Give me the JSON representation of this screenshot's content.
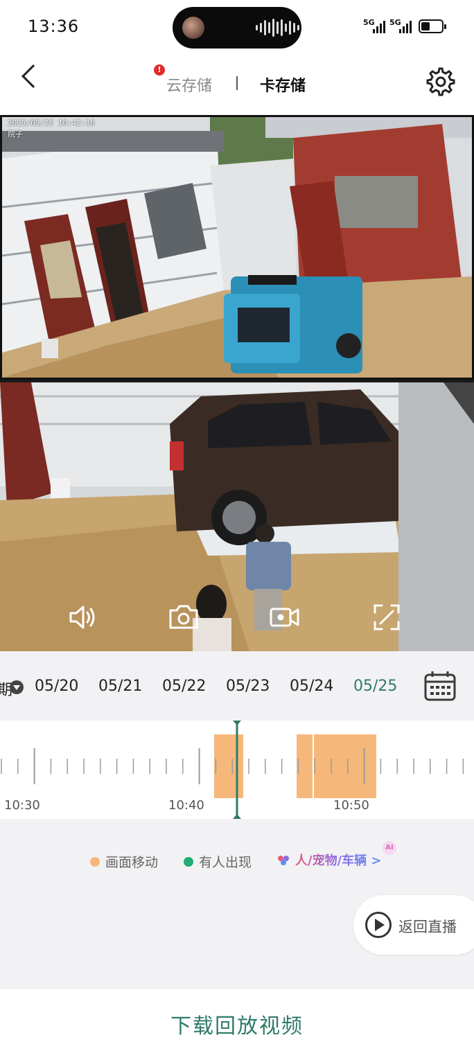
{
  "status_bar": {
    "time": "13:36",
    "network_1": "5G",
    "network_2": "5G"
  },
  "header": {
    "back_icon": "chevron-left-icon",
    "tab_cloud": "云存储",
    "tab_cloud_alert": "!",
    "tab_card": "卡存储",
    "settings_icon": "gear-icon"
  },
  "video": {
    "osd_timestamp": "2025/05/25 10:42:16",
    "osd_camera_name": "院子",
    "controls": [
      "speaker-icon",
      "camera-icon",
      "record-icon",
      "fullscreen-icon"
    ]
  },
  "dates": {
    "prefix": "期",
    "items": [
      "05/20",
      "05/21",
      "05/22",
      "05/23",
      "05/24",
      "05/25"
    ],
    "active": "05/25"
  },
  "timeline": {
    "labels": [
      "10:30",
      "10:40",
      "10:50"
    ],
    "event_color": "#f5b87a",
    "cursor_color": "#2f7a68"
  },
  "legend": {
    "motion": "画面移动",
    "motion_color": "#f5b87a",
    "person": "有人出现",
    "person_color": "#1fae72",
    "ai_filter": "人/宠物/车辆 >",
    "ai_badge": "AI"
  },
  "live_button": "返回直播",
  "download_button": "下载回放视频"
}
